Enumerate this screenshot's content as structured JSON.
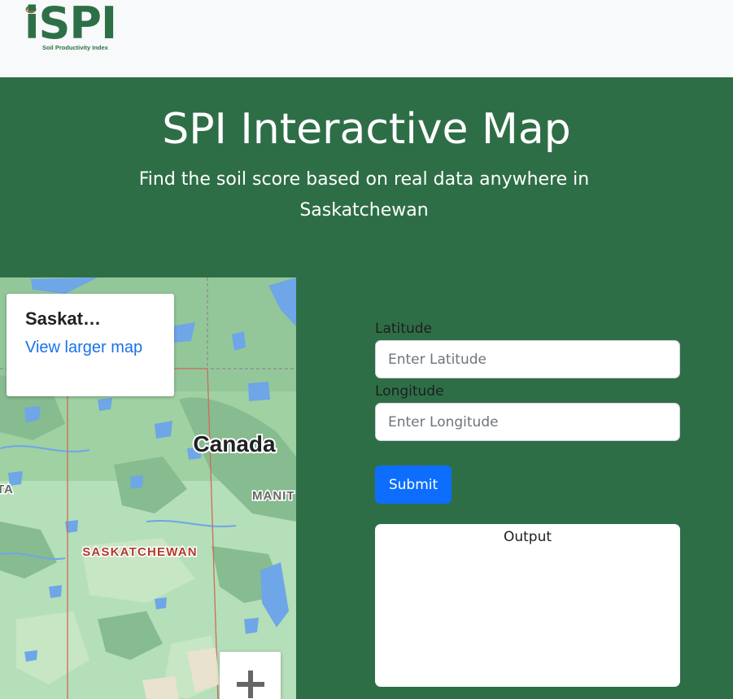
{
  "brand": {
    "logo_text": "iSPI",
    "logo_subtitle": "Soil Productivity Index",
    "color": "#2d7047"
  },
  "hero": {
    "title": "SPI Interactive Map",
    "subtitle": "Find the soil score based on real data anywhere in Saskatchewan",
    "background": "#2e6e47"
  },
  "map": {
    "card_title": "Saskat…",
    "card_link": "View larger map",
    "labels": {
      "country": "Canada",
      "province": "SASKATCHEWAN",
      "east_cut": "MANIT",
      "west_cut": "TA"
    },
    "zoom_in_icon": "plus-icon"
  },
  "form": {
    "latitude_label": "Latitude",
    "latitude_placeholder": "Enter Latitude",
    "latitude_value": "",
    "longitude_label": "Longitude",
    "longitude_placeholder": "Enter Longitude",
    "longitude_value": "",
    "submit_label": "Submit",
    "submit_color": "#0d6efd",
    "output_label": "Output"
  }
}
